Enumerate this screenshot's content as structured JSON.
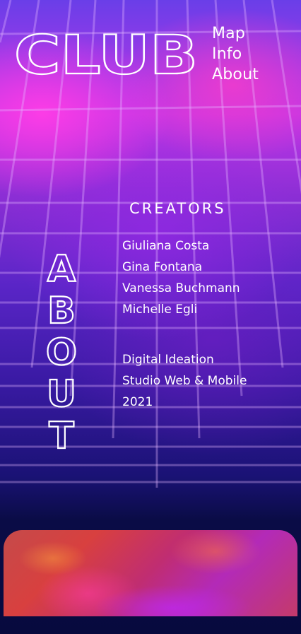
{
  "header": {
    "logo_text": "CLUB",
    "nav": [
      {
        "label": "Map"
      },
      {
        "label": "Info"
      },
      {
        "label": "About"
      }
    ]
  },
  "page": {
    "vertical_title": "ABOUT",
    "creators_heading": "CREATORS",
    "creators": [
      "Giuliana Costa",
      "Gina Fontana",
      "Vanessa Buchmann",
      "Michelle Egli"
    ],
    "credits": [
      "Digital Ideation",
      "Studio Web & Mobile",
      "2021"
    ]
  },
  "colors": {
    "background_top": "#c036e6",
    "background_bottom": "#070a3e",
    "grid_line": "#e6b8ff",
    "text": "#ffffff"
  }
}
